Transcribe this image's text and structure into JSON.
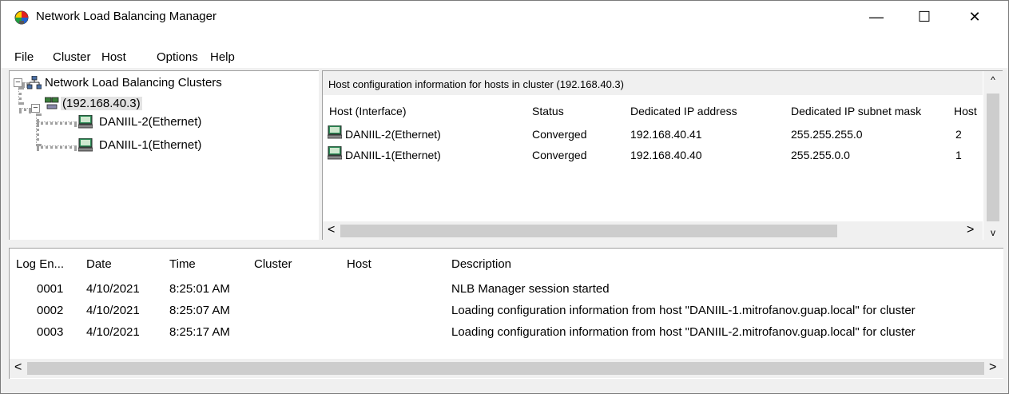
{
  "window": {
    "title": "Network Load Balancing Manager",
    "controls": {
      "minimize": "—",
      "maximize": "☐",
      "close": "✕"
    }
  },
  "menu": [
    "File",
    "Cluster",
    "Host",
    "Options",
    "Help"
  ],
  "tree": {
    "root": "Network Load Balancing Clusters",
    "cluster": "(192.168.40.3)",
    "hosts": [
      "DANIIL-2(Ethernet)",
      "DANIIL-1(Ethernet)"
    ]
  },
  "host_config": {
    "caption": "Host configuration information for hosts in cluster  (192.168.40.3)",
    "columns": [
      "Host (Interface)",
      "Status",
      "Dedicated IP address",
      "Dedicated IP subnet mask",
      "Host"
    ],
    "rows": [
      [
        "DANIIL-2(Ethernet)",
        "Converged",
        "192.168.40.41",
        "255.255.255.0",
        "2"
      ],
      [
        "DANIIL-1(Ethernet)",
        "Converged",
        "192.168.40.40",
        "255.255.0.0",
        "1"
      ]
    ]
  },
  "log": {
    "columns": [
      "Log En...",
      "Date",
      "Time",
      "Cluster",
      "Host",
      "Description"
    ],
    "rows": [
      [
        "0001",
        "4/10/2021",
        "8:25:01 AM",
        "",
        "",
        "NLB Manager session started"
      ],
      [
        "0002",
        "4/10/2021",
        "8:25:07 AM",
        "",
        "",
        "Loading configuration information from host \"DANIIL-1.mitrofanov.guap.local\" for cluster"
      ],
      [
        "0003",
        "4/10/2021",
        "8:25:17 AM",
        "",
        "",
        "Loading configuration information from host \"DANIIL-2.mitrofanov.guap.local\" for cluster"
      ]
    ]
  },
  "icons": {
    "app": "nlb-manager-icon",
    "tree_root": "network-clusters-icon",
    "cluster": "cluster-icon",
    "host": "host-computer-icon"
  },
  "colors": {
    "window_bg": "#f0f0f0",
    "pane_bg": "#ffffff",
    "selection": "#e3e3e3",
    "scroll_thumb": "#cdcdcd"
  }
}
